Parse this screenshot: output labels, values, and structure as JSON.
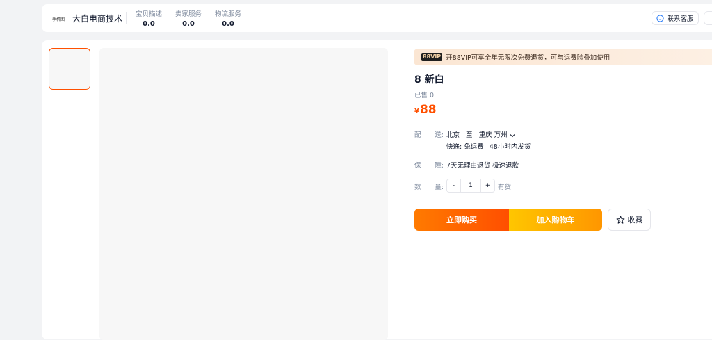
{
  "header": {
    "logo_text": "手机图",
    "shop_name": "大白电商技术",
    "scores": [
      {
        "label": "宝贝描述",
        "value": "0.0"
      },
      {
        "label": "卖家服务",
        "value": "0.0"
      },
      {
        "label": "物流服务",
        "value": "0.0"
      }
    ],
    "contact_label": "联系客服"
  },
  "product": {
    "vip_badge": "88VIP",
    "vip_text": "开88VIP可享全年无限次免费退货，可与运费险叠加使用",
    "title": "8 新白",
    "sold": "已售 0",
    "price_symbol": "¥",
    "price": "88",
    "delivery": {
      "label_a": "配",
      "label_b": "送:",
      "from": "北京",
      "to_word": "至",
      "destination": "重庆 万州",
      "shipping": "快递: 免运费",
      "ship_time": "48小时内发货"
    },
    "guarantee": {
      "label_a": "保",
      "label_b": "障:",
      "text": "7天无理由退货 极速退款"
    },
    "quantity": {
      "label_a": "数",
      "label_b": "量:",
      "minus": "-",
      "value": "1",
      "plus": "+",
      "stock": "有货"
    },
    "buttons": {
      "buy_now": "立即购买",
      "add_to_cart": "加入购物车",
      "favorite": "收藏"
    }
  },
  "colors": {
    "accent": "#ff5000",
    "buy_gradient": [
      "#ff7a00",
      "#ff4f00"
    ],
    "cart_gradient": [
      "#ffc600",
      "#ff9600"
    ]
  }
}
